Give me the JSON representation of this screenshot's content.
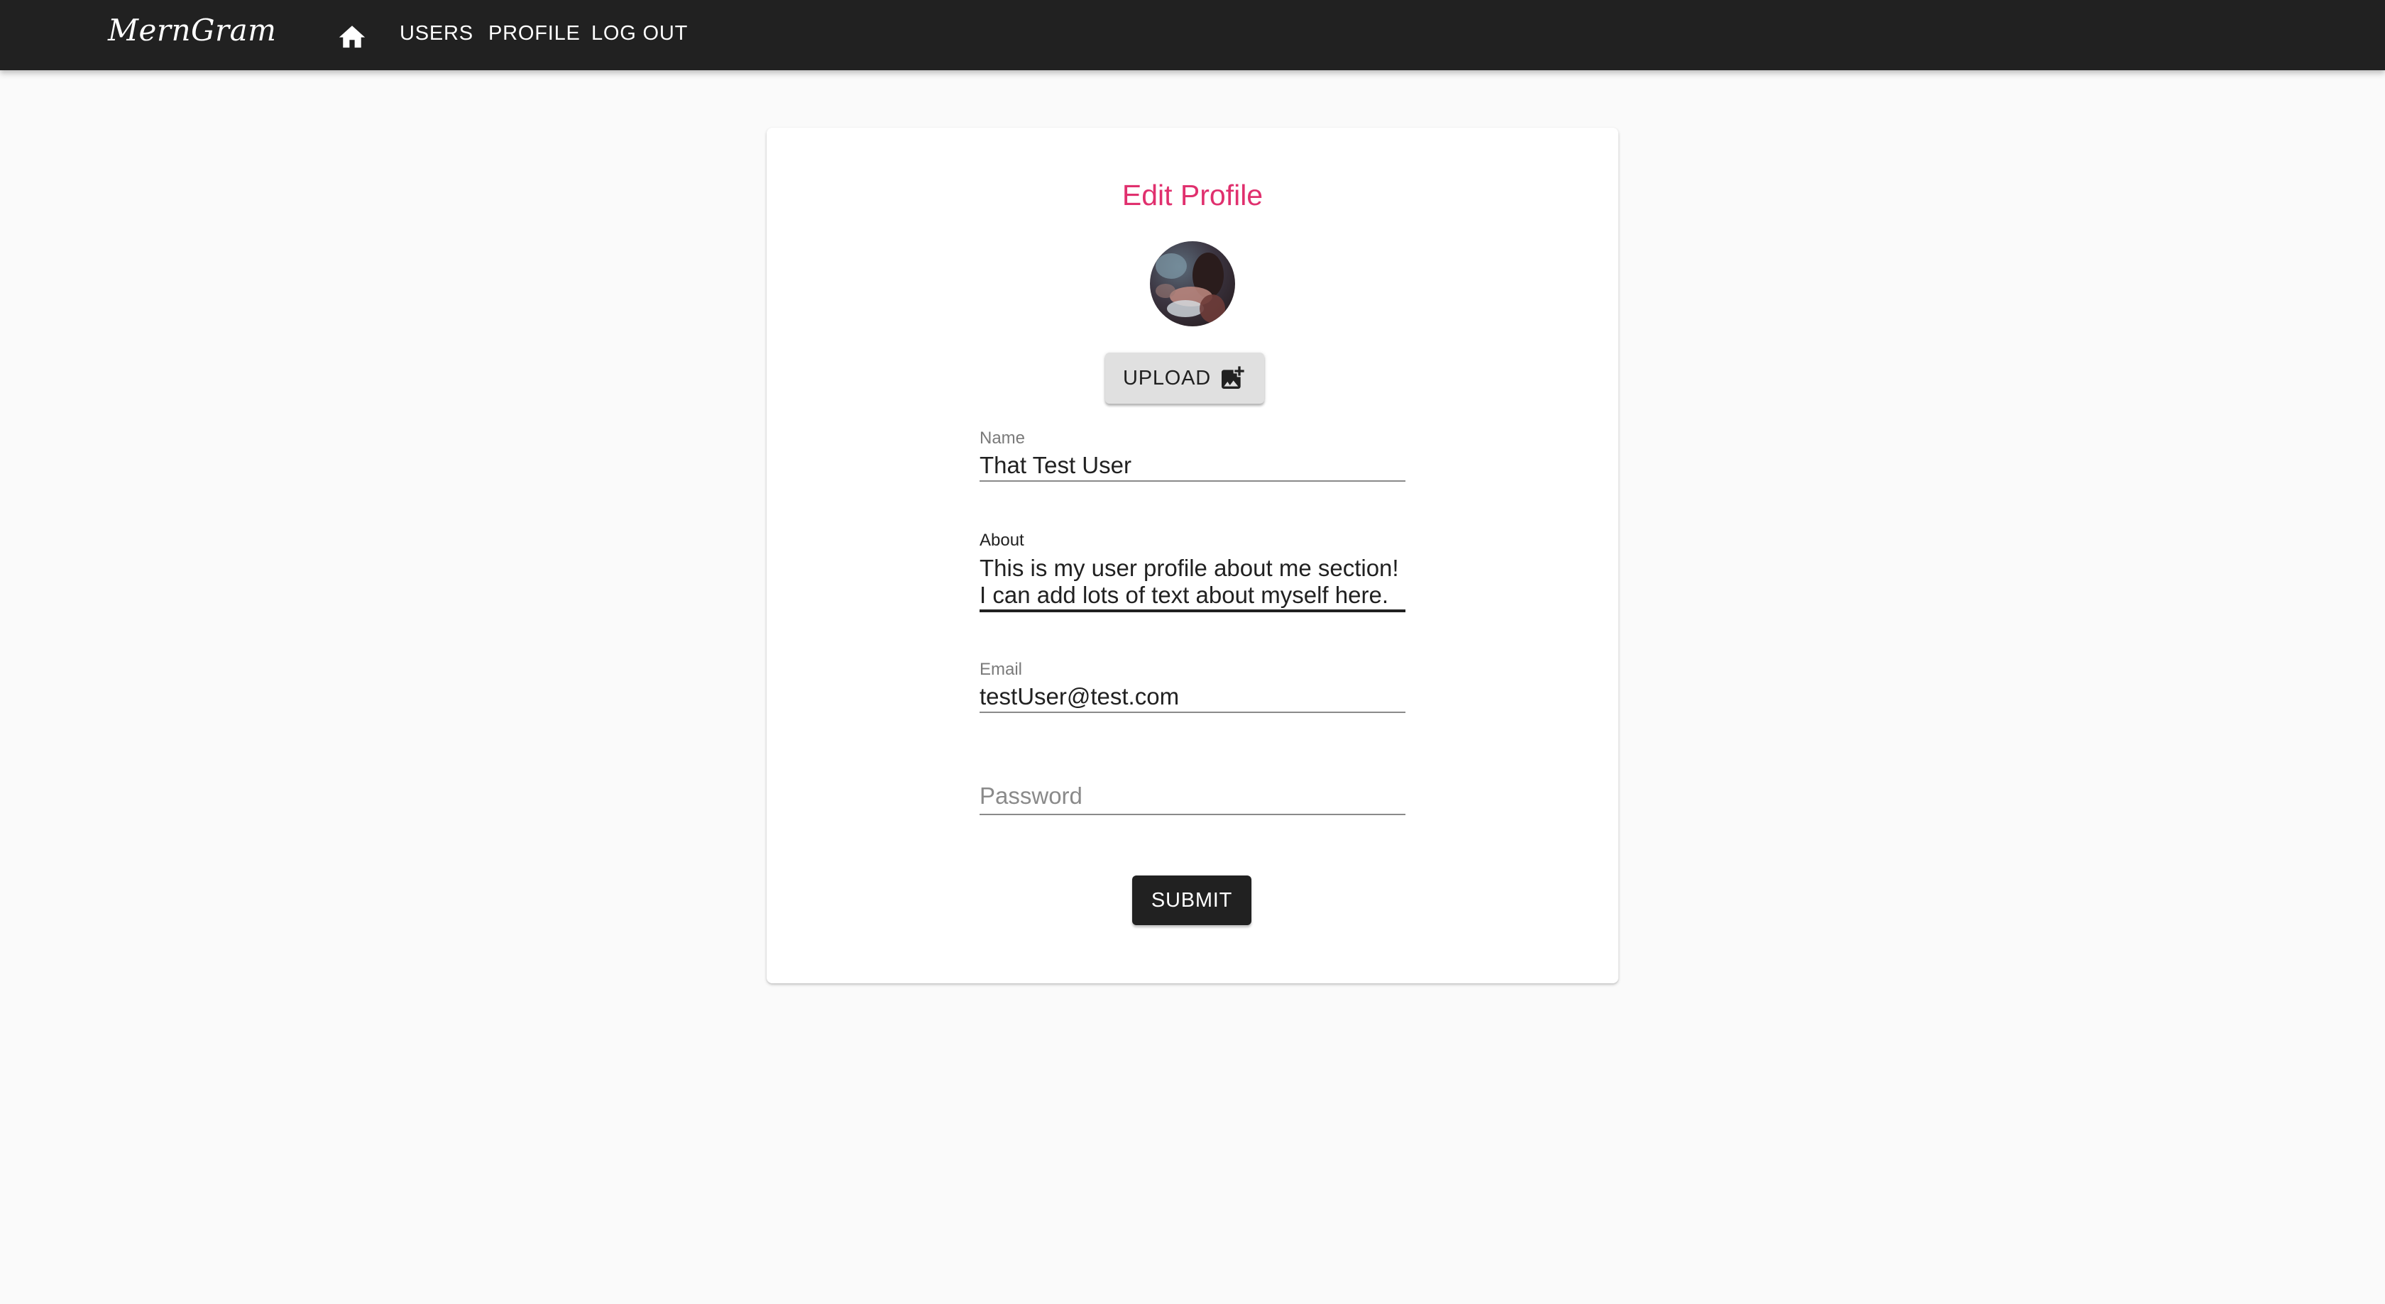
{
  "appbar": {
    "brand": "MernGram",
    "home_icon": "home-icon",
    "nav": [
      {
        "label": "USERS"
      },
      {
        "label": "PROFILE"
      },
      {
        "label": "LOG OUT"
      }
    ]
  },
  "form": {
    "title": "Edit Profile",
    "upload_label": "UPLOAD",
    "upload_icon": "add-photo-icon",
    "fields": {
      "name": {
        "label": "Name",
        "value": "That Test User"
      },
      "about": {
        "label": "About",
        "value": "This is my user profile about me section! I can add lots of text about myself here. "
      },
      "email": {
        "label": "Email",
        "value": "testUser@test.com"
      },
      "password": {
        "placeholder": "Password",
        "value": ""
      }
    },
    "submit_label": "SUBMIT"
  },
  "colors": {
    "appbar": "#212121",
    "title_accent": "#e0306e",
    "background": "#fafafa"
  }
}
